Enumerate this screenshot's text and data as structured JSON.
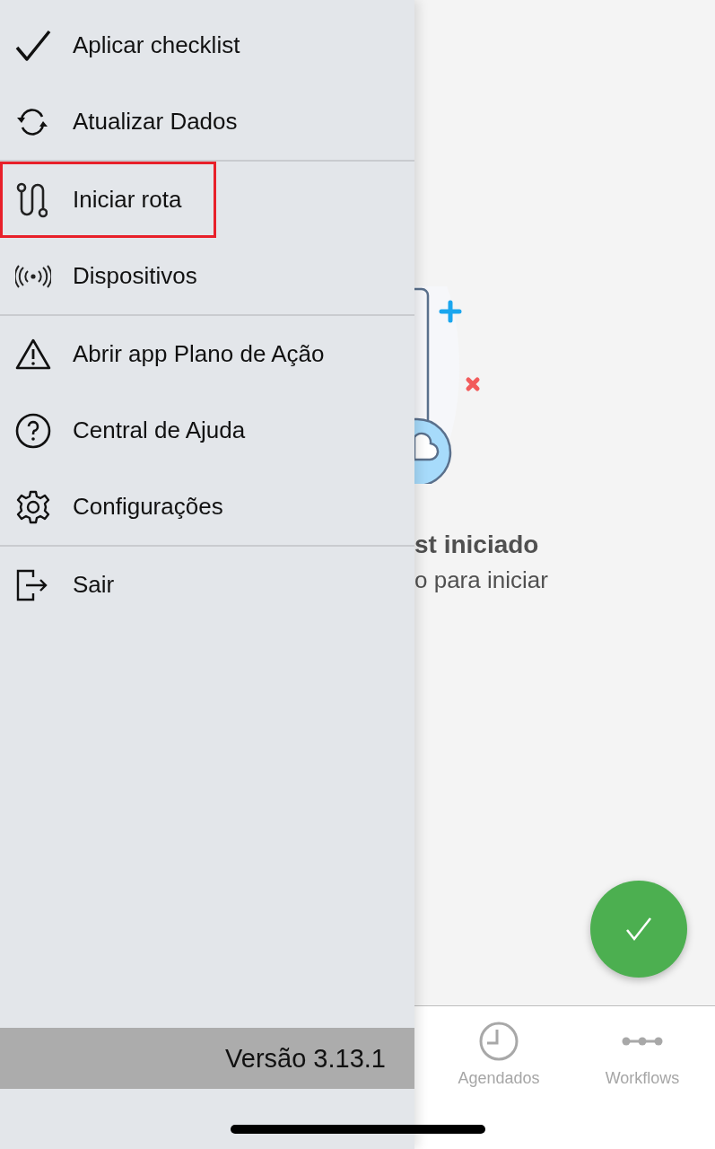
{
  "menu": {
    "groups": [
      {
        "items": [
          {
            "label": "Aplicar checklist",
            "kind": "check",
            "highlighted": false
          },
          {
            "label": "Atualizar Dados",
            "kind": "sync",
            "highlighted": false
          }
        ]
      },
      {
        "items": [
          {
            "label": "Iniciar rota",
            "kind": "route",
            "highlighted": true
          },
          {
            "label": "Dispositivos",
            "kind": "signal",
            "highlighted": false
          }
        ]
      },
      {
        "items": [
          {
            "label": "Abrir app Plano de Ação",
            "kind": "warning",
            "highlighted": false
          },
          {
            "label": "Central de Ajuda",
            "kind": "help",
            "highlighted": false
          },
          {
            "label": "Configurações",
            "kind": "settings",
            "highlighted": false
          }
        ]
      },
      {
        "items": [
          {
            "label": "Sair",
            "kind": "logout",
            "highlighted": false
          }
        ]
      }
    ],
    "version": "Versão 3.13.1"
  },
  "empty_state": {
    "title": "st iniciado",
    "subtitle": "o para iniciar"
  },
  "tab_bar": {
    "items": [
      {
        "label": "Agendados",
        "kind": "clock"
      },
      {
        "label": "Workflows",
        "kind": "flow"
      }
    ]
  }
}
